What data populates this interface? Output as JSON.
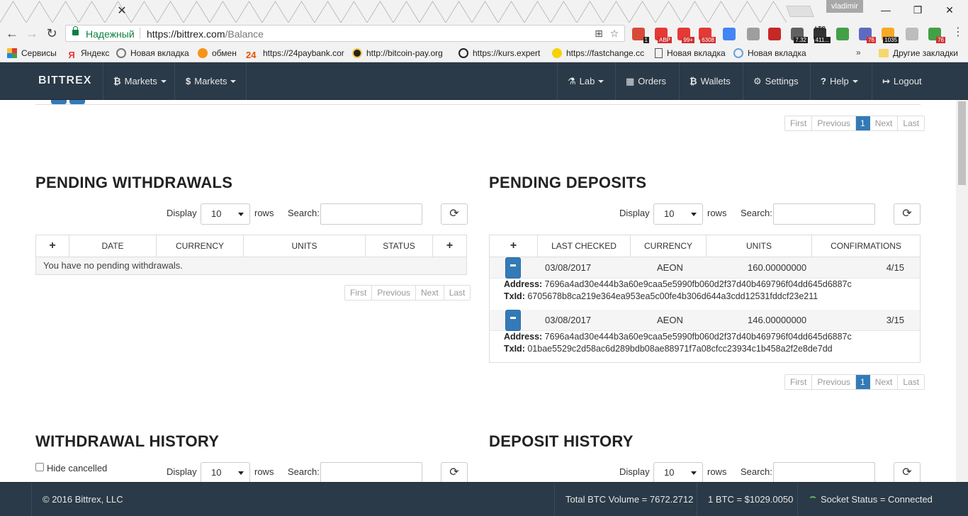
{
  "browser": {
    "user": "vladimir",
    "secure_label": "Надежный",
    "url_domain": "https://bittrex.com",
    "url_path": "/Balance",
    "tab_close": "✕",
    "window": {
      "minimize": "—",
      "restore": "❐",
      "close": "✕"
    },
    "extensions": [
      {
        "name": "ext-1",
        "color": "#d84a38",
        "badge": "1",
        "dark": true
      },
      {
        "name": "adblock",
        "color": "#e53935",
        "badge": "ABP",
        "dark": false
      },
      {
        "name": "ext-99",
        "color": "#e53935",
        "badge": "99+",
        "dark": false
      },
      {
        "name": "gmail",
        "color": "#e53935",
        "badge": "6308",
        "dark": false
      },
      {
        "name": "translate",
        "color": "#4285f4",
        "badge": "",
        "dark": false
      },
      {
        "name": "print",
        "color": "#9e9e9e",
        "badge": "",
        "dark": false
      },
      {
        "name": "pdf",
        "color": "#c62828",
        "badge": "",
        "dark": false
      },
      {
        "name": "ext-732",
        "color": "#616161",
        "badge": "7.32",
        "dark": true
      },
      {
        "name": "ltc",
        "color": "#333333",
        "badge": "411...",
        "dark": true
      },
      {
        "name": "home",
        "color": "#43a047",
        "badge": "",
        "dark": false
      },
      {
        "name": "ext-76a",
        "color": "#5c6bc0",
        "badge": "76",
        "dark": false
      },
      {
        "name": "ext-1035",
        "color": "#f9a825",
        "badge": "1035",
        "dark": true
      },
      {
        "name": "shield",
        "color": "#bdbdbd",
        "badge": "",
        "dark": false
      },
      {
        "name": "ext-76b",
        "color": "#43a047",
        "badge": "76",
        "dark": false
      }
    ],
    "ltc_label": "LTC"
  },
  "bookmarks": [
    {
      "label": "Сервисы",
      "color": "#e53935"
    },
    {
      "label": "Яндекс",
      "color": "#ffffff"
    },
    {
      "label": "Новая вкладка",
      "color": "#888888"
    },
    {
      "label": "обмен",
      "color": "#f7931a"
    },
    {
      "label": "https://24paybank.cor",
      "color": "#ffffff"
    },
    {
      "label": "http://bitcoin-pay.org",
      "color": "#222222"
    },
    {
      "label": "https://kurs.expert",
      "color": "#222222"
    },
    {
      "label": "https://fastchange.cc",
      "color": "#f5d300"
    },
    {
      "label": "Новая вкладка",
      "color": "#ffffff"
    },
    {
      "label": "Новая вкладка",
      "color": "#6aa0d8"
    }
  ],
  "bookmarks_more": "»",
  "bookmarks_other": "Другие закладки",
  "yandex_letter": "Я",
  "pay24_label": "24",
  "nav": {
    "brand": "BITTREX",
    "markets_btc": "Markets",
    "markets_usd": "Markets",
    "btc_symbol": "₿",
    "usd_symbol": "$",
    "lab": "Lab",
    "orders": "Orders",
    "wallets": "Wallets",
    "settings": "Settings",
    "help": "Help",
    "logout": "Logout"
  },
  "pager": {
    "first": "First",
    "previous": "Previous",
    "page": "1",
    "next": "Next",
    "last": "Last"
  },
  "controls": {
    "display": "Display",
    "rows_value": "10",
    "rows": "rows",
    "search": "Search:",
    "refresh": "⟳"
  },
  "pending_withdrawals": {
    "title": "PENDING WITHDRAWALS",
    "columns": [
      "+",
      "DATE",
      "CURRENCY",
      "UNITS",
      "STATUS",
      "+"
    ],
    "empty": "You have no pending withdrawals."
  },
  "pending_deposits": {
    "title": "PENDING DEPOSITS",
    "columns": [
      "+",
      "LAST CHECKED",
      "CURRENCY",
      "UNITS",
      "CONFIRMATIONS"
    ],
    "rows": [
      {
        "date": "03/08/2017",
        "currency": "AEON",
        "units": "160.00000000",
        "confirmations": "4/15",
        "address_label": "Address:",
        "address": "7696a4ad30e444b3a60e9caa5e5990fb060d2f37d40b469796f04dd645d6887c",
        "txid_label": "TxId:",
        "txid": "6705678b8ca219e364ea953ea5c00fe4b306d644a3cdd12531fddcf23e211"
      },
      {
        "date": "03/08/2017",
        "currency": "AEON",
        "units": "146.00000000",
        "confirmations": "3/15",
        "address_label": "Address:",
        "address": "7696a4ad30e444b3a60e9caa5e5990fb060d2f37d40b469796f04dd645d6887c",
        "txid_label": "TxId:",
        "txid": "01bae5529c2d58ac6d289bdb08ae88971f7a08cfcc23934c1b458a2f2e8de7dd"
      }
    ]
  },
  "withdrawal_history": {
    "title": "WITHDRAWAL HISTORY",
    "hide_cancelled": "Hide cancelled"
  },
  "deposit_history": {
    "title": "DEPOSIT HISTORY"
  },
  "footer": {
    "copyright": "© 2016 Bittrex, LLC",
    "volume": "Total BTC Volume = 7672.2712",
    "price": "1 BTC = $1029.0050",
    "socket": "Socket Status = Connected"
  }
}
